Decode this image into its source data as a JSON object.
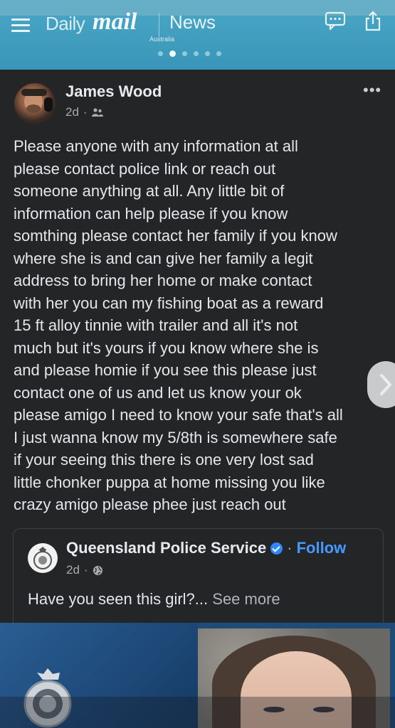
{
  "header": {
    "logo_daily": "Daily",
    "logo_mail": "mail",
    "logo_region": "Australia",
    "section": "News",
    "carousel": {
      "total": 6,
      "active_index": 1
    }
  },
  "post": {
    "author": "James Wood",
    "time": "2d",
    "audience_icon": "friends-icon",
    "body": "Please anyone with any information at all\nplease contact police link or reach out\nsomeone anything at all. Any little bit of\ninformation can help please if you know\nsomthing please contact her family if you know\nwhere she is and can give her family a legit\naddress to bring her home or make contact\nwith her you can my fishing boat as a reward\n15 ft alloy tinnie with trailer and all it's not\nmuch but it's yours if you know where she is\nand please homie if you see this please just\ncontact one of us and let us know your ok\nplease amigo I need to know your safe that's all\nI just wanna know my 5/8th is somewhere safe\nif your seeing this there is one very lost sad\nlittle chonker puppa at home missing you like\ncrazy amigo please phee just reach out"
  },
  "shared_post": {
    "page_name": "Queensland Police Service",
    "separator": "·",
    "follow_label": "Follow",
    "time": "2d",
    "audience_icon": "globe-icon",
    "text": "Have you seen this girl?...",
    "see_more": "See more"
  },
  "colors": {
    "header_blue": "#3a96b8",
    "fb_dark": "#242527",
    "follow_blue": "#4599ff",
    "verified_blue": "#2d88ff"
  }
}
